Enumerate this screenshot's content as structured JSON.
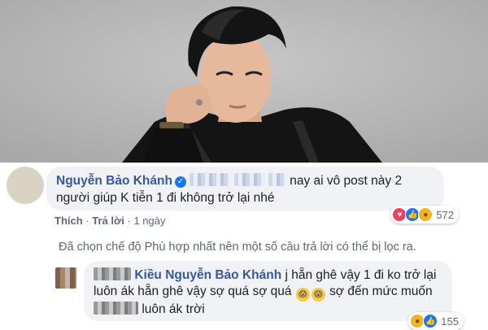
{
  "comment": {
    "author": "Nguyễn Bảo Khánh",
    "text_line1_tail": "nay ai vô post này 2",
    "text_line2": "người giúp K tiễn 1 đi không trở lại nhé",
    "actions": {
      "like": "Thích",
      "reply": "Trả lời",
      "separator": "·",
      "time": "1 ngày"
    },
    "reactions": {
      "icons": [
        "love-reaction",
        "like-reaction",
        "care-reaction"
      ],
      "count": "572"
    }
  },
  "filter_note": "Đã chọn chế độ Phù hợp nhất nên một số câu trả lời có thể bị lọc ra.",
  "reply": {
    "author_partial": "Kiều",
    "mention": "Nguyễn Bảo Khánh",
    "line1_tail": "j hẵn ghê vậy 1 đi ko trở lại",
    "line2_start": "luôn ák hẵn ghê vậy sợ quá sợ quá",
    "emoji_icon": "scream-emoji",
    "line2_end": "sợ đến mức muốn",
    "line3_tail": "luôn ák trời",
    "reactions": {
      "icons": [
        "haha-reaction",
        "like-reaction"
      ],
      "count": "155"
    }
  },
  "colors": {
    "author": "#385898",
    "bubble": "#f0f2f5",
    "meta_text": "#606770",
    "photo_background": "#b6b6b6"
  }
}
